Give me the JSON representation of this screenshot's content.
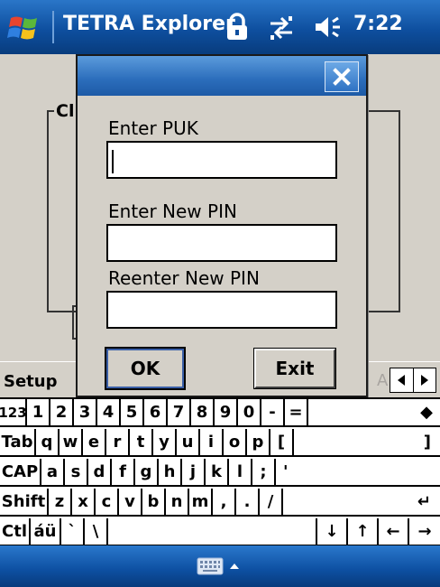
{
  "titlebar": {
    "app_title": "TETRA Explorer",
    "clock": "7:22",
    "icons": [
      "windows-start-icon",
      "lock-icon",
      "connectivity-icon",
      "speaker-icon"
    ]
  },
  "background_app": {
    "cut_text": "Cl",
    "menu": {
      "left_label": "Setup",
      "hidden_letter": "A"
    }
  },
  "dialog": {
    "close_symbol": "✕",
    "puk_label": "Enter PUK",
    "puk_value": "",
    "new_pin_label": "Enter New PIN",
    "new_pin_value": "",
    "reenter_pin_label": "Reenter New PIN",
    "reenter_pin_value": "",
    "ok_label": "OK",
    "exit_label": "Exit"
  },
  "keyboard": {
    "rows": [
      [
        "123",
        "1",
        "2",
        "3",
        "4",
        "5",
        "6",
        "7",
        "8",
        "9",
        "0",
        "-",
        "=",
        "◆"
      ],
      [
        "Tab",
        "q",
        "w",
        "e",
        "r",
        "t",
        "y",
        "u",
        "i",
        "o",
        "p",
        "[",
        "]"
      ],
      [
        "CAP",
        "a",
        "s",
        "d",
        "f",
        "g",
        "h",
        "j",
        "k",
        "l",
        ";",
        "'"
      ],
      [
        "Shift",
        "z",
        "x",
        "c",
        "v",
        "b",
        "n",
        "m",
        ",",
        ".",
        "/",
        "↵"
      ],
      [
        "Ctl",
        "áü",
        "`",
        "\\",
        "",
        "↓",
        "↑",
        "←",
        "→"
      ]
    ]
  },
  "colors": {
    "titlebar": "#0e4f9f",
    "dialog_caption": "#2b6dbb",
    "window_bg": "#d4d0c8",
    "keyboard_bg": "#ffffff"
  }
}
